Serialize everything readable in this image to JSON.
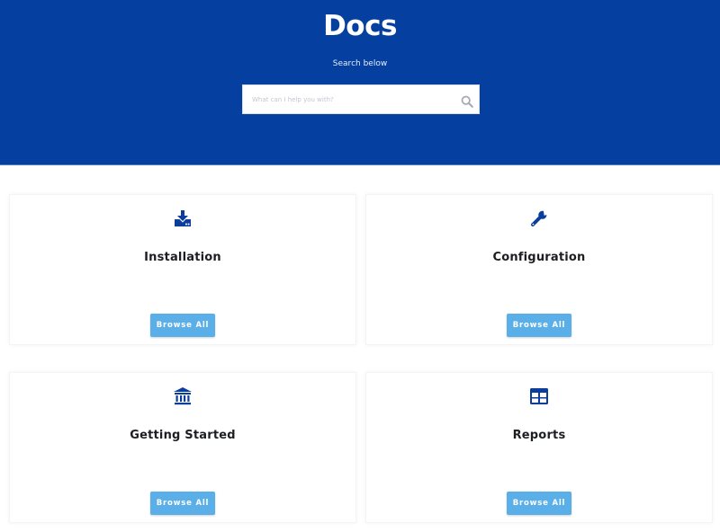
{
  "header": {
    "title": "Docs",
    "subtitle": "Search below",
    "search_placeholder": "What can I help you with?",
    "background_color": "#0540a0"
  },
  "cards": [
    {
      "title": "Installation",
      "icon": "download-icon",
      "button_label": "Browse All"
    },
    {
      "title": "Configuration",
      "icon": "wrench-icon",
      "button_label": "Browse All"
    },
    {
      "title": "Getting Started",
      "icon": "institution-icon",
      "button_label": "Browse All"
    },
    {
      "title": "Reports",
      "icon": "table-icon",
      "button_label": "Browse All"
    }
  ],
  "colors": {
    "icon": "#0b3e9c",
    "button": "#5aafe8"
  }
}
